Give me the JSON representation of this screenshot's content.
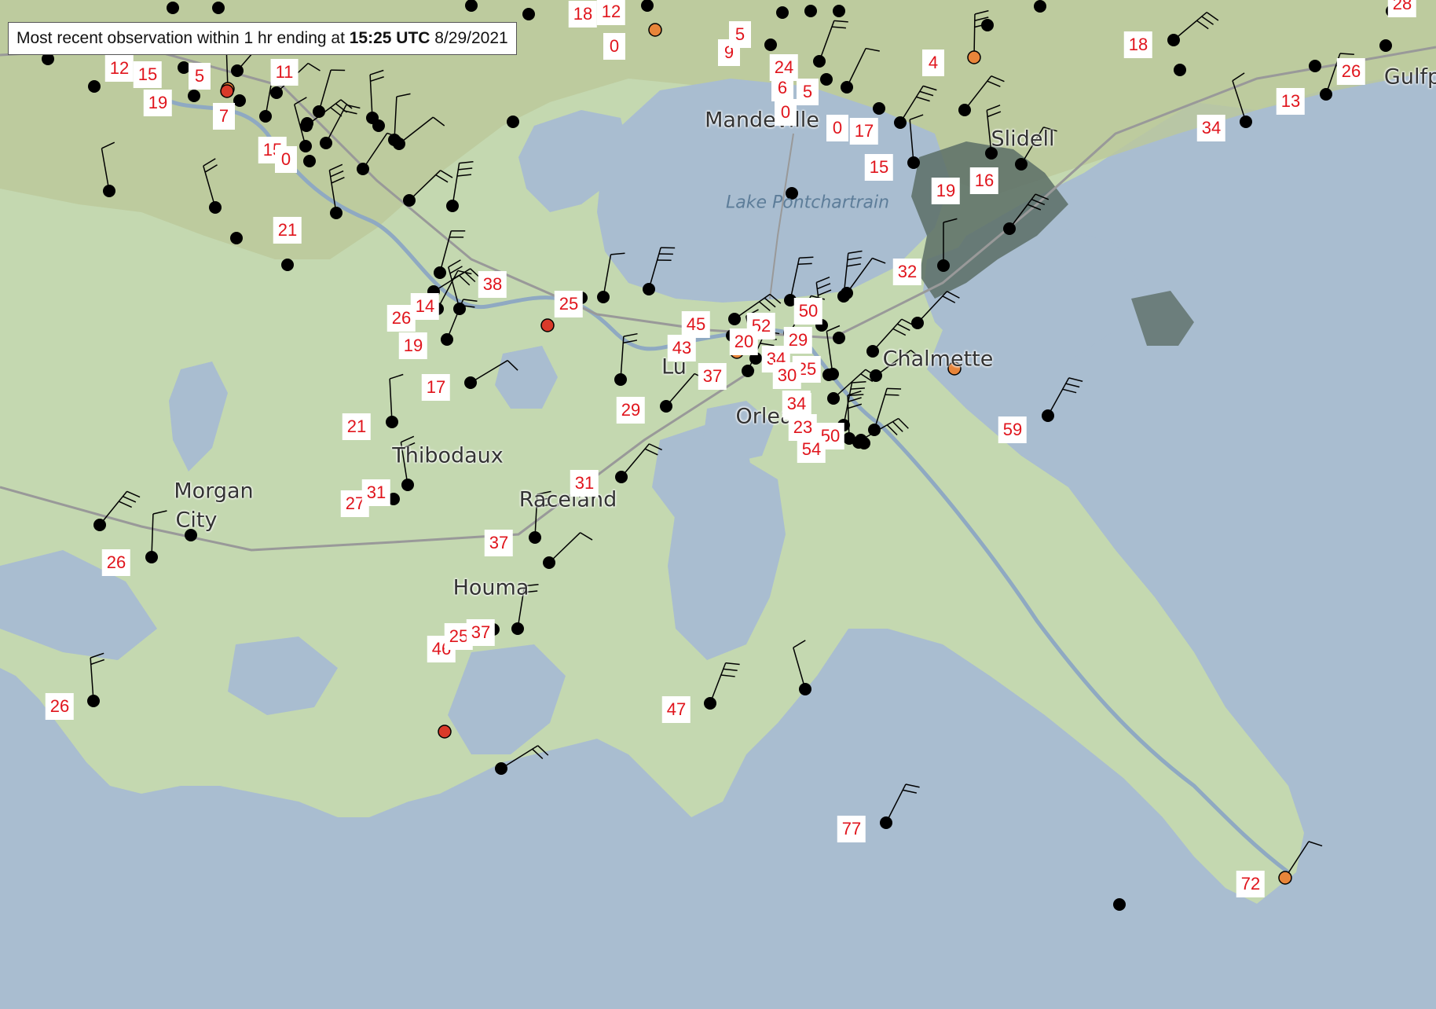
{
  "info_box": {
    "prefix": "Most recent observation within 1 hr ending at",
    "time": "15:25 UTC",
    "date": "8/29/2021"
  },
  "colors": {
    "water": "#a9bdd0",
    "land": "#c4d8b0",
    "land_upland": "#bcc89a",
    "marsh": "#5c6e66",
    "label_text": "#e0141c",
    "station_black": "#000000",
    "station_orange": "#e8853a",
    "station_red": "#d93a2a"
  },
  "places": [
    {
      "name": "Mandeville",
      "lon": -90.07,
      "lat": 30.36
    },
    {
      "name": "Slidell",
      "lon": -89.78,
      "lat": 30.28
    },
    {
      "name": "Gulfp",
      "lon": -89.09,
      "lat": 30.37
    },
    {
      "name": "Chalmette",
      "lon": -89.96,
      "lat": 29.94
    },
    {
      "name": "Orlea",
      "lon": -90.07,
      "lat": 29.95
    },
    {
      "name": "Lu",
      "lon": -90.25,
      "lat": 29.98
    },
    {
      "name": "Thibodaux",
      "lon": -90.82,
      "lat": 29.79
    },
    {
      "name": "Raceland",
      "lon": -90.6,
      "lat": 29.73
    },
    {
      "name": "Morgan",
      "lon": -91.2,
      "lat": 29.7
    },
    {
      "name": "City",
      "lon": -91.2,
      "lat": 29.7
    },
    {
      "name": "Houma",
      "lon": -90.72,
      "lat": 29.59
    }
  ],
  "water_labels": [
    "Lake Pontchartrain"
  ],
  "observations": [
    {
      "label": "12"
    },
    {
      "label": "15"
    },
    {
      "label": "5"
    },
    {
      "label": "11"
    },
    {
      "label": "19"
    },
    {
      "label": "7"
    },
    {
      "label": "15"
    },
    {
      "label": "0"
    },
    {
      "label": "21"
    },
    {
      "label": "18"
    },
    {
      "label": "12"
    },
    {
      "label": "0"
    },
    {
      "label": "9"
    },
    {
      "label": "5"
    },
    {
      "label": "24"
    },
    {
      "label": "6"
    },
    {
      "label": "5"
    },
    {
      "label": "0"
    },
    {
      "label": "0"
    },
    {
      "label": "17"
    },
    {
      "label": "4"
    },
    {
      "label": "18"
    },
    {
      "label": "26"
    },
    {
      "label": "13"
    },
    {
      "label": "34"
    },
    {
      "label": "15"
    },
    {
      "label": "19"
    },
    {
      "label": "16"
    },
    {
      "label": "32"
    },
    {
      "label": "38"
    },
    {
      "label": "25"
    },
    {
      "label": "26"
    },
    {
      "label": "14"
    },
    {
      "label": "19"
    },
    {
      "label": "17"
    },
    {
      "label": "21"
    },
    {
      "label": "45"
    },
    {
      "label": "52"
    },
    {
      "label": "50"
    },
    {
      "label": "43"
    },
    {
      "label": "20"
    },
    {
      "label": "29"
    },
    {
      "label": "25"
    },
    {
      "label": "34"
    },
    {
      "label": "37"
    },
    {
      "label": "30"
    },
    {
      "label": "25"
    },
    {
      "label": "29"
    },
    {
      "label": "34"
    },
    {
      "label": "23"
    },
    {
      "label": "50"
    },
    {
      "label": "54"
    },
    {
      "label": "59"
    },
    {
      "label": "31"
    },
    {
      "label": "27"
    },
    {
      "label": "31"
    },
    {
      "label": "26"
    },
    {
      "label": "37"
    },
    {
      "label": "46"
    },
    {
      "label": "25"
    },
    {
      "label": "37"
    },
    {
      "label": "26"
    },
    {
      "label": "47"
    },
    {
      "label": "77"
    },
    {
      "label": "72"
    },
    {
      "label": "28"
    }
  ]
}
